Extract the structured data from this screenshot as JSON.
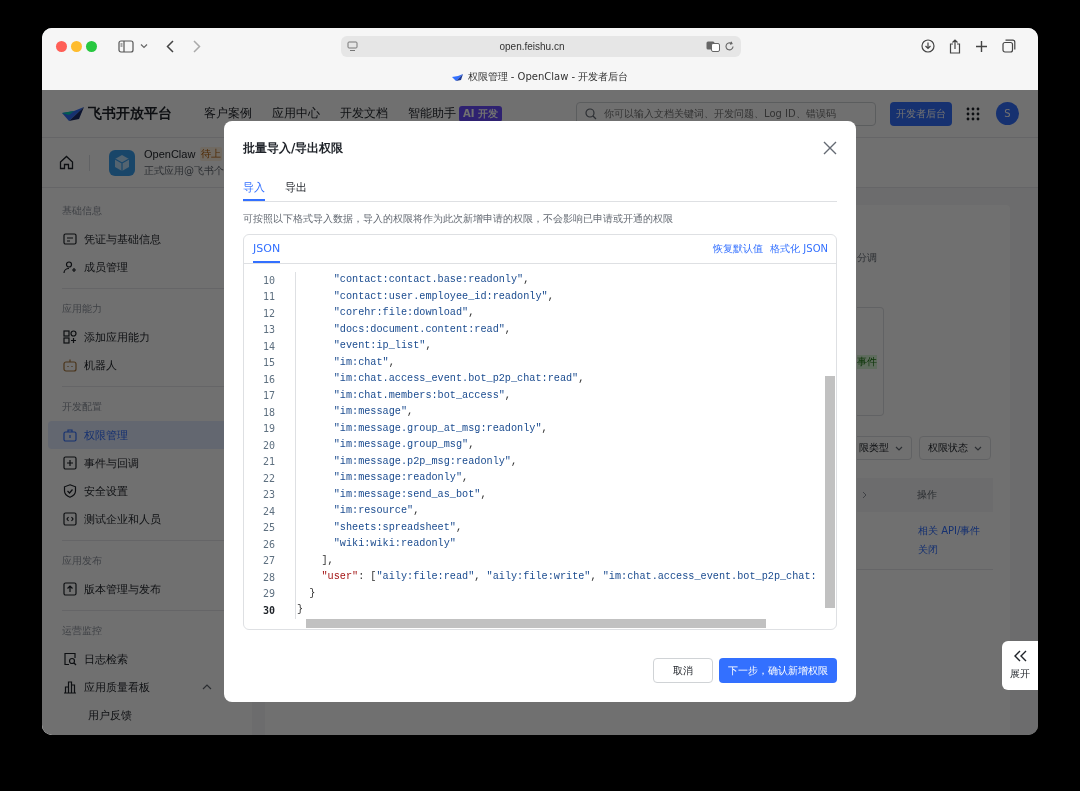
{
  "browser": {
    "url": "open.feishu.cn",
    "tab_title": "权限管理 - OpenClaw - 开发者后台"
  },
  "header": {
    "logo": "飞书开放平台",
    "nav": [
      {
        "label": "客户案例"
      },
      {
        "label": "应用中心"
      },
      {
        "label": "开发文档"
      },
      {
        "label": "智能助手",
        "badge": "AI 开发"
      }
    ],
    "search": {
      "placeholder": "你可以输入文档关键词、开发问题、Log ID、错误码"
    },
    "console_button": "开发者后台",
    "avatar": "S"
  },
  "app": {
    "name": "OpenClaw",
    "status": "待上",
    "subtitle": "正式应用@飞书个"
  },
  "sidebar": {
    "groups": [
      {
        "heading": "基础信息",
        "items": [
          {
            "label": "凭证与基础信息",
            "selected": false
          },
          {
            "label": "成员管理",
            "selected": false
          }
        ]
      },
      {
        "heading": "应用能力",
        "items": [
          {
            "label": "添加应用能力",
            "selected": false
          },
          {
            "label": "机器人",
            "selected": false
          }
        ]
      },
      {
        "heading": "开发配置",
        "items": [
          {
            "label": "权限管理",
            "selected": true
          },
          {
            "label": "事件与回调",
            "selected": false
          },
          {
            "label": "安全设置",
            "selected": false
          },
          {
            "label": "测试企业和人员",
            "selected": false
          }
        ]
      },
      {
        "heading": "应用发布",
        "items": [
          {
            "label": "版本管理与发布",
            "selected": false
          }
        ]
      },
      {
        "heading": "运营监控",
        "items": [
          {
            "label": "日志检索",
            "selected": false
          },
          {
            "label": "应用质量看板",
            "selected": false,
            "expanded": true,
            "children": [
              {
                "label": "用户反馈",
                "selected": false
              }
            ]
          }
        ]
      }
    ]
  },
  "content": {
    "fragment": "分调",
    "tag": "事件",
    "filters": [
      {
        "label": "限类型"
      },
      {
        "label": "权限状态"
      }
    ],
    "table": {
      "columns": [
        {
          "label": "操作"
        }
      ],
      "actions": [
        "相关 API/事件",
        "关闭"
      ]
    }
  },
  "modal": {
    "title": "批量导入/导出权限",
    "tabs": [
      {
        "label": "导入",
        "selected": true
      },
      {
        "label": "导出",
        "selected": false
      }
    ],
    "description": "可按照以下格式导入数据，导入的权限将作为此次新增申请的权限，不会影响已申请或开通的权限",
    "editor": {
      "tabs": [
        {
          "label": "JSON",
          "selected": true
        }
      ],
      "actions": [
        "恢复默认值",
        "格式化 JSON"
      ],
      "lines": [
        {
          "number": "10",
          "current": false,
          "tokens": [
            {
              "kind": "string",
              "text": "      \"contact:contact.base:readonly\""
            },
            {
              "kind": "punct",
              "text": ","
            }
          ]
        },
        {
          "number": "11",
          "current": false,
          "tokens": [
            {
              "kind": "string",
              "text": "      \"contact:user.employee_id:readonly\""
            },
            {
              "kind": "punct",
              "text": ","
            }
          ]
        },
        {
          "number": "12",
          "current": false,
          "tokens": [
            {
              "kind": "string",
              "text": "      \"corehr:file:download\""
            },
            {
              "kind": "punct",
              "text": ","
            }
          ]
        },
        {
          "number": "13",
          "current": false,
          "tokens": [
            {
              "kind": "string",
              "text": "      \"docs:document.content:read\""
            },
            {
              "kind": "punct",
              "text": ","
            }
          ]
        },
        {
          "number": "14",
          "current": false,
          "tokens": [
            {
              "kind": "string",
              "text": "      \"event:ip_list\""
            },
            {
              "kind": "punct",
              "text": ","
            }
          ]
        },
        {
          "number": "15",
          "current": false,
          "tokens": [
            {
              "kind": "string",
              "text": "      \"im:chat\""
            },
            {
              "kind": "punct",
              "text": ","
            }
          ]
        },
        {
          "number": "16",
          "current": false,
          "tokens": [
            {
              "kind": "string",
              "text": "      \"im:chat.access_event.bot_p2p_chat:read\""
            },
            {
              "kind": "punct",
              "text": ","
            }
          ]
        },
        {
          "number": "17",
          "current": false,
          "tokens": [
            {
              "kind": "string",
              "text": "      \"im:chat.members:bot_access\""
            },
            {
              "kind": "punct",
              "text": ","
            }
          ]
        },
        {
          "number": "18",
          "current": false,
          "tokens": [
            {
              "kind": "string",
              "text": "      \"im:message\""
            },
            {
              "kind": "punct",
              "text": ","
            }
          ]
        },
        {
          "number": "19",
          "current": false,
          "tokens": [
            {
              "kind": "string",
              "text": "      \"im:message.group_at_msg:readonly\""
            },
            {
              "kind": "punct",
              "text": ","
            }
          ]
        },
        {
          "number": "20",
          "current": false,
          "tokens": [
            {
              "kind": "string",
              "text": "      \"im:message.group_msg\""
            },
            {
              "kind": "punct",
              "text": ","
            }
          ]
        },
        {
          "number": "21",
          "current": false,
          "tokens": [
            {
              "kind": "string",
              "text": "      \"im:message.p2p_msg:readonly\""
            },
            {
              "kind": "punct",
              "text": ","
            }
          ]
        },
        {
          "number": "22",
          "current": false,
          "tokens": [
            {
              "kind": "string",
              "text": "      \"im:message:readonly\""
            },
            {
              "kind": "punct",
              "text": ","
            }
          ]
        },
        {
          "number": "23",
          "current": false,
          "tokens": [
            {
              "kind": "string",
              "text": "      \"im:message:send_as_bot\""
            },
            {
              "kind": "punct",
              "text": ","
            }
          ]
        },
        {
          "number": "24",
          "current": false,
          "tokens": [
            {
              "kind": "string",
              "text": "      \"im:resource\""
            },
            {
              "kind": "punct",
              "text": ","
            }
          ]
        },
        {
          "number": "25",
          "current": false,
          "tokens": [
            {
              "kind": "string",
              "text": "      \"sheets:spreadsheet\""
            },
            {
              "kind": "punct",
              "text": ","
            }
          ]
        },
        {
          "number": "26",
          "current": false,
          "tokens": [
            {
              "kind": "string",
              "text": "      \"wiki:wiki:readonly\""
            }
          ]
        },
        {
          "number": "27",
          "current": false,
          "tokens": [
            {
              "kind": "punct",
              "text": "    ],"
            }
          ]
        },
        {
          "number": "28",
          "current": false,
          "tokens": [
            {
              "kind": "key",
              "text": "    \"user\""
            },
            {
              "kind": "punct",
              "text": ": ["
            },
            {
              "kind": "string",
              "text": "\"aily:file:read\""
            },
            {
              "kind": "punct",
              "text": ", "
            },
            {
              "kind": "string",
              "text": "\"aily:file:write\""
            },
            {
              "kind": "punct",
              "text": ", "
            },
            {
              "kind": "string",
              "text": "\"im:chat.access_event.bot_p2p_chat:"
            }
          ]
        },
        {
          "number": "29",
          "current": false,
          "tokens": [
            {
              "kind": "punct",
              "text": "  }"
            }
          ]
        },
        {
          "number": "30",
          "current": true,
          "tokens": [
            {
              "kind": "punct",
              "text": "}"
            }
          ]
        }
      ]
    },
    "buttons": [
      {
        "label": "取消",
        "kind": "secondary"
      },
      {
        "label": "下一步，确认新增权限",
        "kind": "primary"
      }
    ]
  },
  "expand_button": {
    "label": "展开"
  }
}
